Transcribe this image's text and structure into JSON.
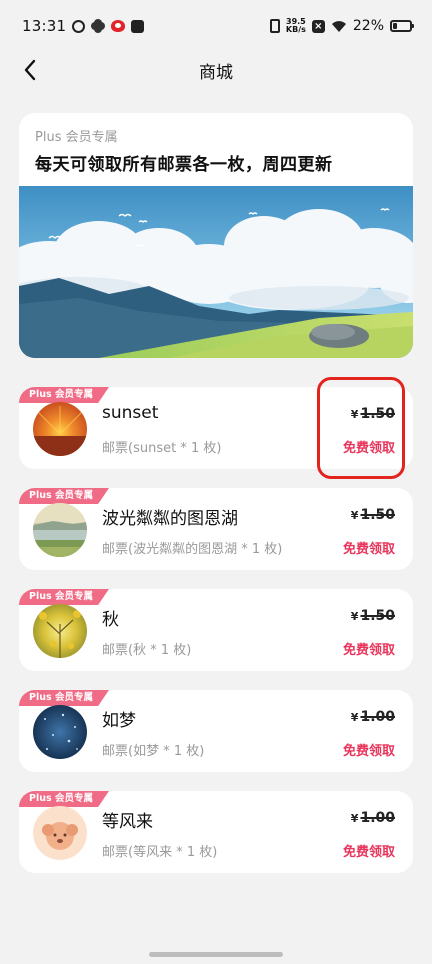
{
  "status_bar": {
    "time": "13:31",
    "net_speed_top": "39.5",
    "net_speed_bottom": "KB/s",
    "battery": "22%",
    "left_icons": [
      "link-icon",
      "pinwheel-icon",
      "weibo-icon",
      "notification-box-icon"
    ],
    "right_icons": [
      "vibrate-icon",
      "net-speed",
      "sim-x-icon",
      "wifi-icon",
      "battery-icon"
    ]
  },
  "header": {
    "title": "商城"
  },
  "banner": {
    "tag": "Plus 会员专属",
    "title": "每天可领取所有邮票各一枚，周四更新"
  },
  "items": [
    {
      "badge": "Plus 会员专属",
      "name": "sunset",
      "desc": "邮票(sunset * 1 枚)",
      "currency": "¥",
      "price": "1.50",
      "action": "免费领取"
    },
    {
      "badge": "Plus 会员专属",
      "name": " 波光粼粼的图恩湖",
      "desc": "邮票(波光粼粼的图恩湖 * 1 枚)",
      "currency": "¥",
      "price": "1.50",
      "action": "免费领取"
    },
    {
      "badge": "Plus 会员专属",
      "name": "秋",
      "desc": "邮票(秋 * 1 枚)",
      "currency": "¥",
      "price": "1.50",
      "action": "免费领取"
    },
    {
      "badge": "Plus 会员专属",
      "name": "如梦",
      "desc": "邮票(如梦 * 1 枚)",
      "currency": "¥",
      "price": "1.00",
      "action": "免费领取"
    },
    {
      "badge": "Plus 会员专属",
      "name": "等风来",
      "desc": "邮票(等风来 * 1 枚)",
      "currency": "¥",
      "price": "1.00",
      "action": "免费领取"
    }
  ],
  "colors": {
    "accent": "#e8355c",
    "badge": "#f06b86",
    "highlight": "#e2231e",
    "background": "#f2f2f2"
  }
}
